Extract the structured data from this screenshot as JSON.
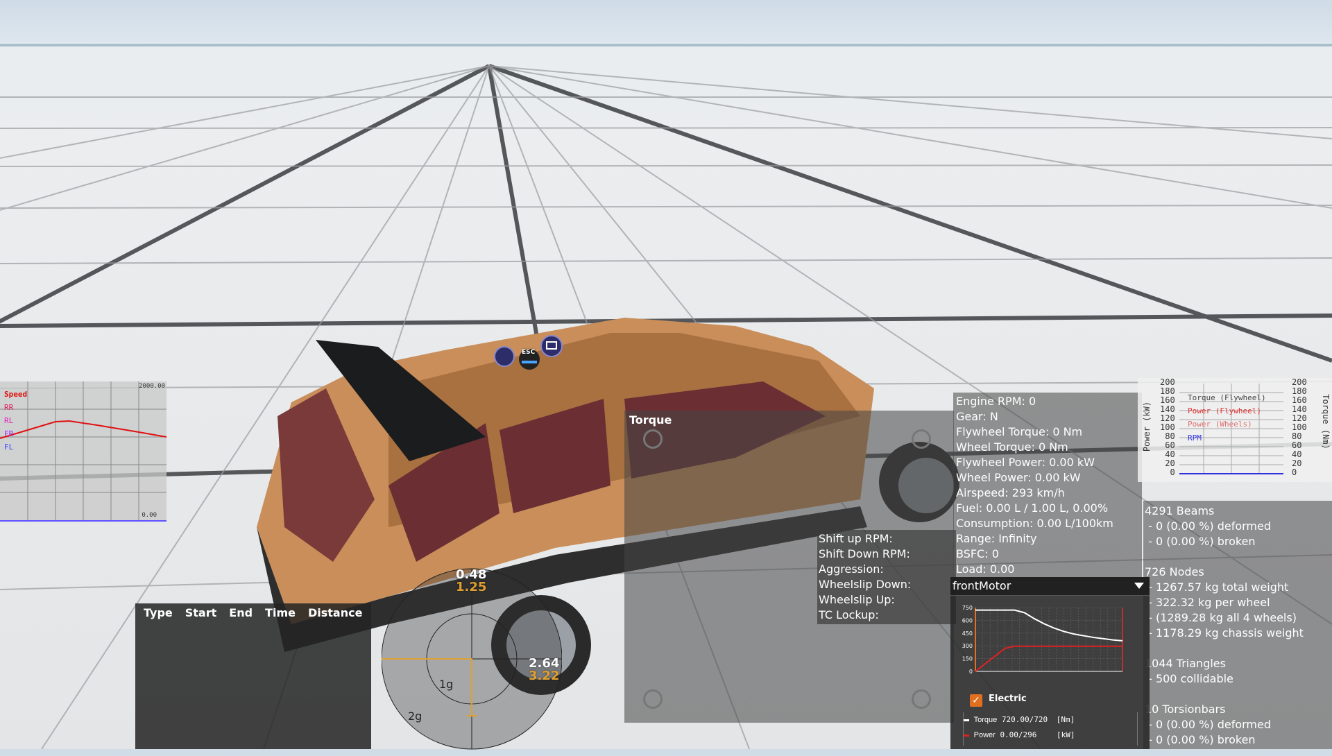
{
  "speed_graph": {
    "title": "Speed",
    "labels": [
      "RR",
      "RL",
      "FR",
      "FL"
    ],
    "max_label": "2000.00",
    "min_label": "0.00",
    "colors": {
      "speed": "#e01010",
      "rr": "#e02060",
      "rl": "#e020c0",
      "fr": "#a020ff",
      "fl": "#4040ff"
    }
  },
  "ai_icons": {
    "esc_label": "ESC"
  },
  "timing_table": {
    "headers": [
      "Type",
      "Start",
      "End",
      "Time",
      "Distance"
    ]
  },
  "g_meter": {
    "top_white": "0.48",
    "top_orange": "1.25",
    "right_white": "2.64",
    "right_orange": "3.22",
    "ring1": "1g",
    "ring2": "2g"
  },
  "torque_panel": {
    "title": "Torque"
  },
  "shift_panel": {
    "lines": [
      "Shift up RPM:",
      "Shift Down RPM:",
      "Aggression:",
      "Wheelslip Down:",
      "Wheelslip Up:",
      "TC Lockup:"
    ]
  },
  "engine_info": {
    "lines": [
      "Engine RPM: 0",
      "Gear: N",
      "Flywheel Torque: 0 Nm",
      "Wheel Torque: 0 Nm",
      "Flywheel Power: 0.00 kW",
      "Wheel Power: 0.00 kW",
      "Airspeed: 293 km/h",
      "Fuel: 0.00 L / 1.00 L, 0.00%",
      "Consumption: 0.00 L/100km",
      "Range: Infinity",
      "BSFC: 0",
      "Load: 0.00"
    ]
  },
  "power_graph": {
    "left_axis": "Power (kW)",
    "right_axis": "Torque (Nm)",
    "ticks": [
      "200",
      "180",
      "160",
      "140",
      "120",
      "100",
      "80",
      "60",
      "40",
      "20",
      "0"
    ],
    "legend": [
      {
        "label": "Torque (Flywheel)",
        "color": "#444444"
      },
      {
        "label": "Power (Flywheel)",
        "color": "#e03030"
      },
      {
        "label": "Power (Wheels)",
        "color": "#e07070"
      },
      {
        "label": "RPM",
        "color": "#3030e0"
      }
    ]
  },
  "beam_stats": {
    "lines": [
      "4291 Beams",
      " - 0 (0.00 %) deformed",
      " - 0 (0.00 %) broken",
      "",
      "726 Nodes",
      " - 1267.57 kg total weight",
      " - 322.32 kg per wheel",
      " - (1289.28 kg all 4 wheels)",
      " - 1178.29 kg chassis weight",
      "",
      "1044 Triangles",
      " - 500 collidable",
      "",
      "10 Torsionbars",
      " - 0 (0.00 %) deformed",
      " - 0 (0.00 %) broken"
    ]
  },
  "motor_panel": {
    "dropdown": "frontMotor",
    "checkbox_label": "Electric",
    "y_ticks": [
      "750",
      "600",
      "450",
      "300",
      "150",
      "0"
    ],
    "legend": [
      {
        "label": "Torque",
        "value": "720.00/720",
        "unit": "[Nm]",
        "color": "#ffffff"
      },
      {
        "label": "Power",
        "value": "0.00/296",
        "unit": "[kW]",
        "color": "#e02020"
      }
    ],
    "colors": {
      "torque": "#ffffff",
      "power": "#e02020",
      "accent": "#e07020"
    }
  },
  "chart_data": [
    {
      "type": "line",
      "title": "",
      "x": [
        0,
        0.2,
        0.4,
        0.6,
        0.8,
        1.0,
        1.2,
        1.4,
        1.6,
        1.8,
        2.0,
        2.2,
        2.4,
        2.6,
        2.8,
        3.0
      ],
      "series": [
        {
          "name": "",
          "values": [
            720,
            720,
            720,
            720,
            720,
            690,
            620,
            560,
            510,
            470,
            440,
            420,
            400,
            385,
            370,
            360
          ]
        },
        {
          "name": "",
          "values": [
            0,
            90,
            180,
            270,
            296,
            296,
            296,
            296,
            296,
            296,
            296,
            296,
            296,
            296,
            296,
            296
          ]
        }
      ],
      "ylim": [
        0,
        750
      ]
    }
  ]
}
